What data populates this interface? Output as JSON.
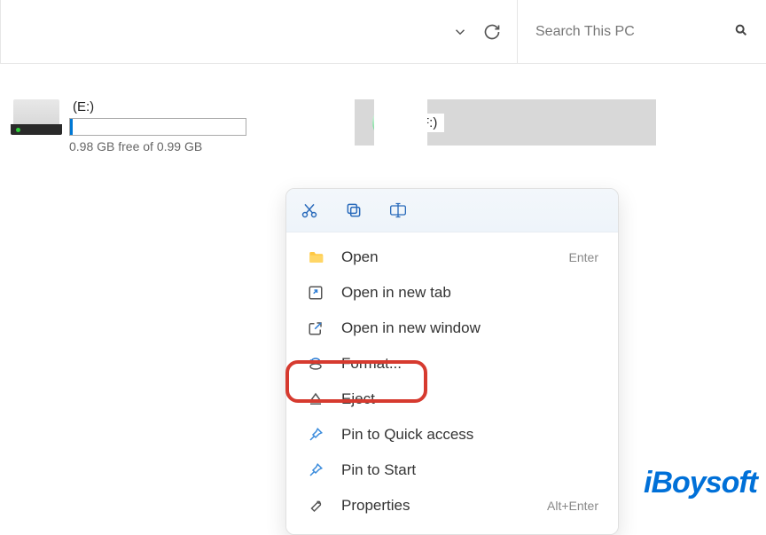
{
  "search": {
    "placeholder": "Search This PC"
  },
  "drives": {
    "e": {
      "label": "(E:)",
      "free_text": "0.98 GB free of 0.99 GB"
    },
    "f": {
      "label": "(F:)"
    }
  },
  "context_menu": {
    "items": [
      {
        "icon": "folder-icon",
        "label": "Open",
        "shortcut": "Enter"
      },
      {
        "icon": "new-tab-icon",
        "label": "Open in new tab",
        "shortcut": ""
      },
      {
        "icon": "new-window-icon",
        "label": "Open in new window",
        "shortcut": ""
      },
      {
        "icon": "format-icon",
        "label": "Format...",
        "shortcut": ""
      },
      {
        "icon": "eject-icon",
        "label": "Eject",
        "shortcut": ""
      },
      {
        "icon": "pin-icon",
        "label": "Pin to Quick access",
        "shortcut": ""
      },
      {
        "icon": "pin-icon",
        "label": "Pin to Start",
        "shortcut": ""
      },
      {
        "icon": "wrench-icon",
        "label": "Properties",
        "shortcut": "Alt+Enter"
      }
    ]
  },
  "watermark": "iBoysoft"
}
